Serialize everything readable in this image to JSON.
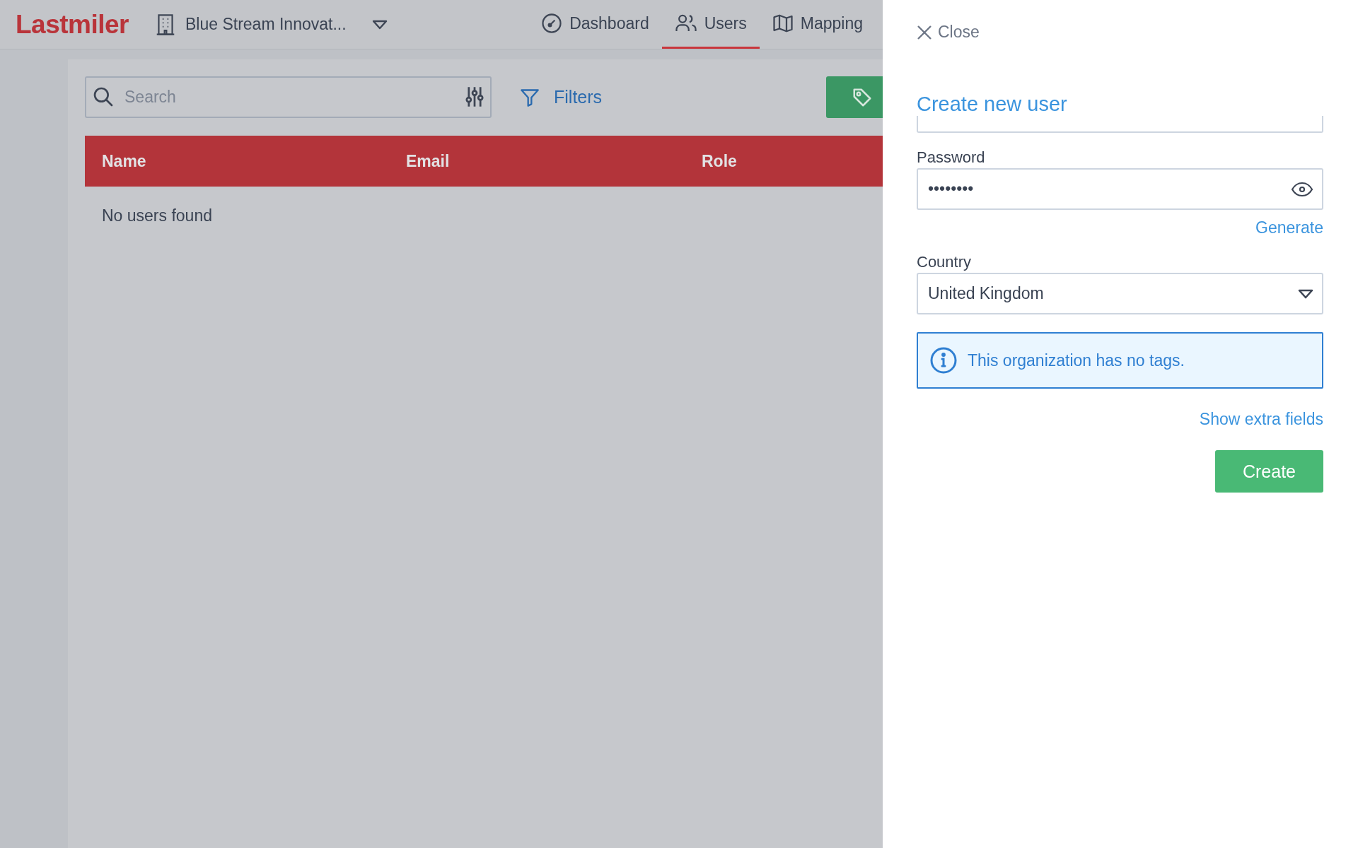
{
  "app": {
    "logo": "Lastmiler",
    "organization": "Blue Stream Innovat..."
  },
  "nav": [
    {
      "kind": "dashboard",
      "label": "Dashboard",
      "selected": false
    },
    {
      "kind": "users",
      "label": "Users",
      "selected": true
    },
    {
      "kind": "map",
      "label": "Mapping",
      "selected": false
    }
  ],
  "toolbar": {
    "search": {
      "placeholder": "Search"
    },
    "filters": "Filters"
  },
  "table": {
    "columns": [
      "Name",
      "Email",
      "Role"
    ],
    "empty_message": "No users found"
  },
  "panel": {
    "close": "Close",
    "title": "Create new user",
    "fields": [
      {
        "kind": "partial"
      },
      {
        "kind": "password",
        "label": "Password",
        "value": "••••••••",
        "action": "Generate"
      },
      {
        "kind": "select",
        "label": "Country",
        "value": "United Kingdom"
      }
    ],
    "notice": "This organization has no tags.",
    "extra_link": "Show extra fields",
    "submit": "Create"
  }
}
